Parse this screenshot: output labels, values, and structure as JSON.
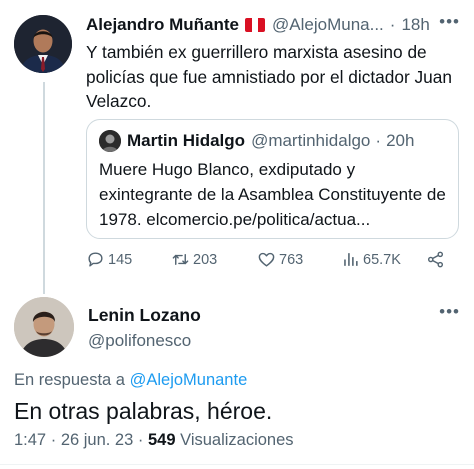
{
  "parent_tweet": {
    "display_name": "Alejandro Muñante",
    "flag_icon": "peru-flag-icon",
    "flag_colors": [
      "#d91023",
      "#ffffff",
      "#d91023"
    ],
    "handle": "@AlejoMuna...",
    "separator": "·",
    "time": "18h",
    "text": "Y también ex guerrillero marxista asesino de policías que fue amnistiado por el dictador Juan Velazco.",
    "quote": {
      "display_name": "Martin Hidalgo",
      "handle": "@martinhidalgo",
      "separator": "·",
      "time": "20h",
      "text": "Muere Hugo Blanco, exdiputado y exintegrante de la Asamblea Constituyente de 1978. elcomercio.pe/politica/actua..."
    },
    "actions": {
      "replies": "145",
      "retweets": "203",
      "likes": "763",
      "views": "65.7K"
    }
  },
  "reply_tweet": {
    "display_name": "Lenin Lozano",
    "handle": "@polifonesco",
    "replying_prefix": "En respuesta a",
    "replying_to": "@AlejoMunante",
    "text": "En otras palabras, héroe.",
    "time": "1:47",
    "separator": "·",
    "date": "26 jun. 23",
    "separator2": "·",
    "views_count": "549",
    "views_label": "Visualizaciones"
  },
  "colors": {
    "text": "#0f1419",
    "secondary": "#536471",
    "link": "#1d9bf0",
    "border": "#cfd9de"
  }
}
